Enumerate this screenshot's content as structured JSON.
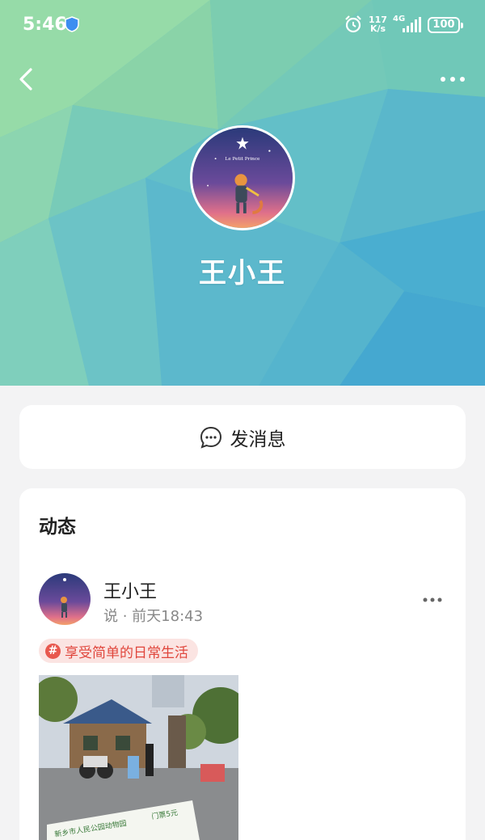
{
  "status_bar": {
    "time": "5:46",
    "speed_value": "117",
    "speed_unit": "K/s",
    "network": "4G",
    "battery": "100"
  },
  "profile": {
    "name": "王小王",
    "avatar_text": "Le Petit Prince"
  },
  "message_button": {
    "label": "发消息"
  },
  "feed": {
    "title": "动态",
    "post": {
      "user": "王小王",
      "meta": "说 · 前天18:43",
      "tag": "享受简单的日常生活",
      "photo_sign": "新乡市人民公园动物园",
      "photo_price": "门票5元"
    }
  },
  "icons": {
    "back": "back-arrow-icon",
    "more": "more-dots-icon",
    "message": "chat-bubble-icon",
    "alarm": "alarm-clock-icon",
    "shield": "shield-icon"
  },
  "colors": {
    "tag_bg": "#fbe4e2",
    "tag_text": "#e0463c",
    "header_teal": "#5bbccf",
    "header_green": "#8fd6a6"
  }
}
